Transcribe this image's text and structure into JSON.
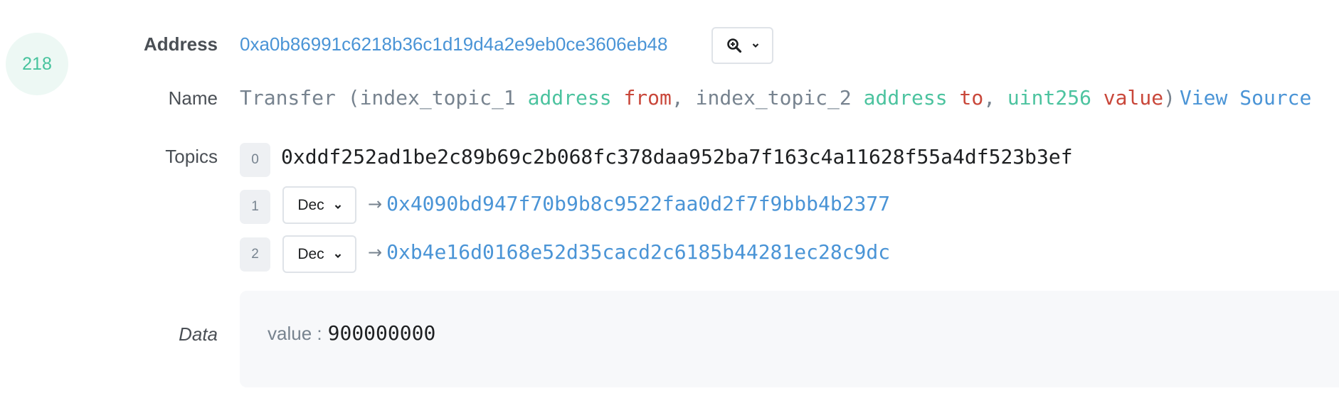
{
  "log": {
    "index": "218",
    "address": {
      "label": "Address",
      "value": "0xa0b86991c6218b36c1d19d4a2e9eb0ce3606eb48",
      "zoom_button_icon": "zoom-in-icon"
    },
    "name": {
      "label": "Name",
      "tokens": [
        {
          "text": "Transfer (index_topic_1 ",
          "kind": "gray"
        },
        {
          "text": "address",
          "kind": "green"
        },
        {
          "text": " from",
          "kind": "red"
        },
        {
          "text": ", index_topic_2 ",
          "kind": "gray"
        },
        {
          "text": "address",
          "kind": "green"
        },
        {
          "text": " to",
          "kind": "red"
        },
        {
          "text": ", ",
          "kind": "gray"
        },
        {
          "text": "uint256",
          "kind": "green"
        },
        {
          "text": " value",
          "kind": "red"
        },
        {
          "text": ")",
          "kind": "gray"
        }
      ],
      "view_source_label": "View Source"
    },
    "topics": {
      "label": "Topics",
      "items": [
        {
          "index": "0",
          "value": "0xddf252ad1be2c89b69c2b068fc378daa952ba7f163c4a11628f55a4df523b3ef"
        },
        {
          "index": "1",
          "format": "Dec",
          "arrow": "→",
          "value": "0x4090bd947f70b9b8c9522faa0d2f7f9bbb4b2377"
        },
        {
          "index": "2",
          "format": "Dec",
          "arrow": "→",
          "value": "0xb4e16d0168e52d35cacd2c6185b44281ec28c9dc"
        }
      ]
    },
    "data": {
      "label": "Data",
      "key": "value :",
      "value": "900000000"
    }
  },
  "colors": {
    "link": "#4a94d6",
    "type_green": "#4cc39f",
    "param_red": "#c9473a",
    "muted": "#77838f",
    "index_circle_bg": "#edf8f4",
    "index_circle_text": "#47c39d"
  }
}
